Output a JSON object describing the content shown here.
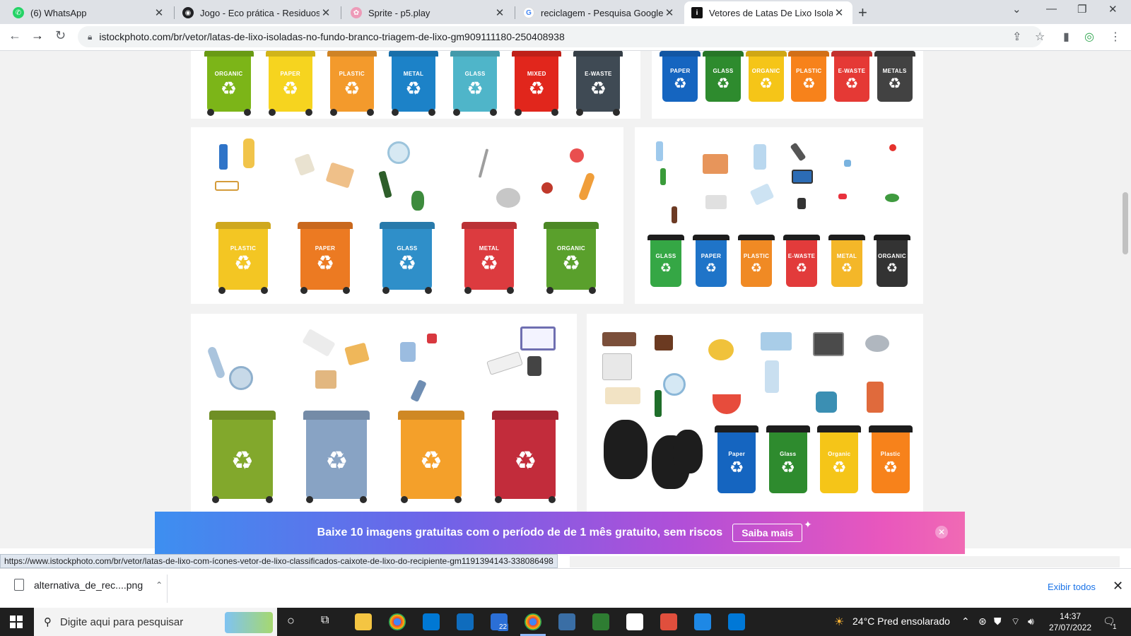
{
  "browser": {
    "tabs": [
      {
        "title": "(6) WhatsApp",
        "favicon": "whatsapp-icon",
        "color": "#25d366"
      },
      {
        "title": "Jogo - Eco prática - Residuos",
        "favicon": "globe-icon",
        "color": "#202124"
      },
      {
        "title": "Sprite - p5.play",
        "favicon": "flower-icon",
        "color": "#ed9bb8"
      },
      {
        "title": "reciclagem - Pesquisa Google",
        "favicon": "google-icon",
        "color": "#4285f4"
      },
      {
        "title": "Vetores de Latas De Lixo Isoladas",
        "favicon": "istock-icon",
        "color": "#111111",
        "active": true
      }
    ],
    "url": "istockphoto.com/br/vetor/latas-de-lixo-isoladas-no-fundo-branco-triagem-de-lixo-gm909111180-250408938"
  },
  "page": {
    "card1_bins": [
      {
        "label": "ORGANIC",
        "color": "#7cb518"
      },
      {
        "label": "PAPER",
        "color": "#f6d41f"
      },
      {
        "label": "PLASTIC",
        "color": "#f39a2c"
      },
      {
        "label": "METAL",
        "color": "#1c82c8"
      },
      {
        "label": "GLASS",
        "color": "#4fb5c9"
      },
      {
        "label": "MIXED",
        "color": "#e1261c"
      },
      {
        "label": "E-WASTE",
        "color": "#3f4a54"
      }
    ],
    "card2_bins": [
      {
        "label": "PAPER",
        "color": "#1565c0"
      },
      {
        "label": "GLASS",
        "color": "#2e8b2e"
      },
      {
        "label": "ORGANIC",
        "color": "#f5c518"
      },
      {
        "label": "PLASTIC",
        "color": "#f7821b"
      },
      {
        "label": "E-WASTE",
        "color": "#e53935"
      },
      {
        "label": "METALS",
        "color": "#424242"
      }
    ],
    "card3_bins": [
      {
        "label": "PLASTIC",
        "color": "#f3c623"
      },
      {
        "label": "PAPER",
        "color": "#ec7a22"
      },
      {
        "label": "GLASS",
        "color": "#2f8fc9"
      },
      {
        "label": "METAL",
        "color": "#dc3b3f"
      },
      {
        "label": "ORGANIC",
        "color": "#5aa02c"
      }
    ],
    "card4_bins": [
      {
        "label": "GLASS",
        "color": "#35a745"
      },
      {
        "label": "PAPER",
        "color": "#1f74c8"
      },
      {
        "label": "PLASTIC",
        "color": "#f08a24"
      },
      {
        "label": "E-WASTE",
        "color": "#e23b3b"
      },
      {
        "label": "METAL",
        "color": "#f4b729"
      },
      {
        "label": "ORGANIC",
        "color": "#333333"
      }
    ],
    "card5_bins": [
      {
        "label": "",
        "color": "#82a82c"
      },
      {
        "label": "",
        "color": "#88a3c4"
      },
      {
        "label": "",
        "color": "#f4a02a"
      },
      {
        "label": "",
        "color": "#c22c3b"
      }
    ],
    "card6_bins": [
      {
        "label": "Paper",
        "color": "#1565c0"
      },
      {
        "label": "Glass",
        "color": "#2e8b2e"
      },
      {
        "label": "Organic",
        "color": "#f5c518"
      },
      {
        "label": "Plastic",
        "color": "#f7821b"
      }
    ],
    "recycle_symbol": "♻"
  },
  "promo": {
    "text": "Baixe 10 imagens gratuitas com o período de de 1 mês gratuito, sem riscos",
    "cta": "Saiba mais"
  },
  "status_url": "https://www.istockphoto.com/br/vetor/latas-de-lixo-com-ícones-vetor-de-lixo-classificados-caixote-de-lixo-do-recipiente-gm1191394143-338086498",
  "downloads": {
    "file": "alternativa_de_rec....png",
    "show_all": "Exibir todos"
  },
  "taskbar": {
    "search_placeholder": "Digite aqui para pesquisar",
    "weather": "24°C  Pred ensolarado",
    "time": "14:37",
    "date": "27/07/2022",
    "badge": "22",
    "notifications": "1"
  }
}
